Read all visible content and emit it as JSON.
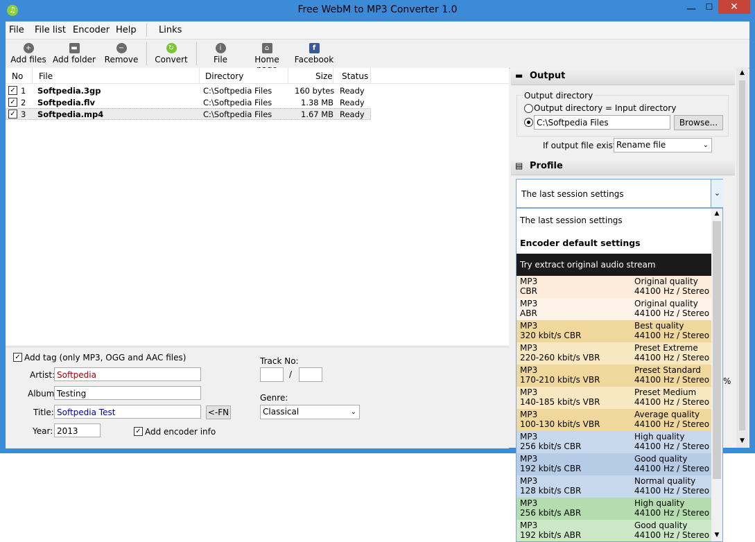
{
  "window": {
    "title": "Free WebM to MP3 Converter 1.0",
    "app_icon": "music-note-icon",
    "min": "—",
    "max": "☐",
    "close": "✕"
  },
  "menu": [
    "File",
    "File list",
    "Encoder",
    "Help",
    "Links"
  ],
  "toolbar": [
    {
      "label": "Add files",
      "icon": "plus-icon",
      "color": "#6a6a6a"
    },
    {
      "label": "Add folder",
      "icon": "folder-icon",
      "color": "#6a6a6a"
    },
    {
      "label": "Remove",
      "icon": "minus-icon",
      "color": "#6a6a6a"
    },
    {
      "label": "Convert",
      "icon": "convert-icon",
      "color": "#7cc532"
    },
    {
      "label": "File",
      "icon": "info-icon",
      "color": "#6a6a6a"
    },
    {
      "label": "Home page",
      "icon": "home-icon",
      "color": "#6a6a6a"
    },
    {
      "label": "Facebook",
      "icon": "facebook-icon",
      "color": "#3b5998"
    }
  ],
  "filelist": {
    "columns": [
      "No",
      "File",
      "Directory",
      "Size",
      "Status"
    ],
    "rows": [
      {
        "no": "1",
        "file": "Softpedia.3gp",
        "dir": "C:\\Softpedia Files",
        "size": "160 bytes",
        "status": "Ready"
      },
      {
        "no": "2",
        "file": "Softpedia.flv",
        "dir": "C:\\Softpedia Files",
        "size": "1.38 MB",
        "status": "Ready"
      },
      {
        "no": "3",
        "file": "Softpedia.mp4",
        "dir": "C:\\Softpedia Files",
        "size": "1.67 MB",
        "status": "Ready"
      }
    ]
  },
  "tags": {
    "add_tag": "Add tag (only MP3, OGG and AAC files)",
    "artist_label": "Artist:",
    "artist": "Softpedia",
    "album_label": "Album:",
    "album": "Testing",
    "title_label": "Title:",
    "title": "Softpedia Test",
    "fn_button": "<-FN",
    "year_label": "Year:",
    "year": "2013",
    "encoder_info": "Add encoder info",
    "track_label": "Track No:",
    "track_sep": "/",
    "genre_label": "Genre:",
    "genre": "Classical"
  },
  "output": {
    "header": "Output",
    "group": "Output directory",
    "radio1": "Output directory = Input directory",
    "path": "C:\\Softpedia Files",
    "browse": "Browse...",
    "exists_label": "If output file exists:",
    "exists_value": "Rename file"
  },
  "profile": {
    "header": "Profile",
    "selected": "The last session settings",
    "percent_fragment": "%",
    "options": [
      {
        "l1": "The last session settings",
        "bg": "#ffffff",
        "kind": "single"
      },
      {
        "l1": "Encoder default settings",
        "bg": "#ffffff",
        "kind": "bold"
      },
      {
        "l1": "Try extract original audio stream",
        "bg": "#1a1a1a",
        "kind": "dark"
      },
      {
        "l1": "MP3",
        "l2": "CBR",
        "r1": "Original quality",
        "r2": "44100 Hz / Stereo",
        "bg": "#fcecd9"
      },
      {
        "l1": "MP3",
        "l2": "ABR",
        "r1": "Original quality",
        "r2": "44100 Hz / Stereo",
        "bg": "#fdf3e8"
      },
      {
        "l1": "MP3",
        "l2": "320 kbit/s CBR",
        "r1": "Best quality",
        "r2": "44100 Hz / Stereo",
        "bg": "#f0d89c"
      },
      {
        "l1": "MP3",
        "l2": "220-260 kbit/s VBR",
        "r1": "Preset Extreme",
        "r2": "44100 Hz / Stereo",
        "bg": "#f7e8c2"
      },
      {
        "l1": "MP3",
        "l2": "170-210 kbit/s VBR",
        "r1": "Preset Standard",
        "r2": "44100 Hz / Stereo",
        "bg": "#f0d89c"
      },
      {
        "l1": "MP3",
        "l2": "140-185 kbit/s VBR",
        "r1": "Preset Medium",
        "r2": "44100 Hz / Stereo",
        "bg": "#f7e8c2"
      },
      {
        "l1": "MP3",
        "l2": "100-130 kbit/s VBR",
        "r1": "Average quality",
        "r2": "44100 Hz / Stereo",
        "bg": "#f0d89c"
      },
      {
        "l1": "MP3",
        "l2": "256 kbit/s CBR",
        "r1": "High quality",
        "r2": "44100 Hz / Stereo",
        "bg": "#c8d8ec"
      },
      {
        "l1": "MP3",
        "l2": "192 kbit/s CBR",
        "r1": "Good quality",
        "r2": "44100 Hz / Stereo",
        "bg": "#b6cbe6"
      },
      {
        "l1": "MP3",
        "l2": "128 kbit/s CBR",
        "r1": "Normal quality",
        "r2": "44100 Hz / Stereo",
        "bg": "#c8d8ec"
      },
      {
        "l1": "MP3",
        "l2": "256 kbit/s ABR",
        "r1": "High quality",
        "r2": "44100 Hz / Stereo",
        "bg": "#b4dcae"
      },
      {
        "l1": "MP3",
        "l2": "192 kbit/s ABR",
        "r1": "Good quality",
        "r2": "44100 Hz / Stereo",
        "bg": "#cce8c6"
      }
    ]
  }
}
